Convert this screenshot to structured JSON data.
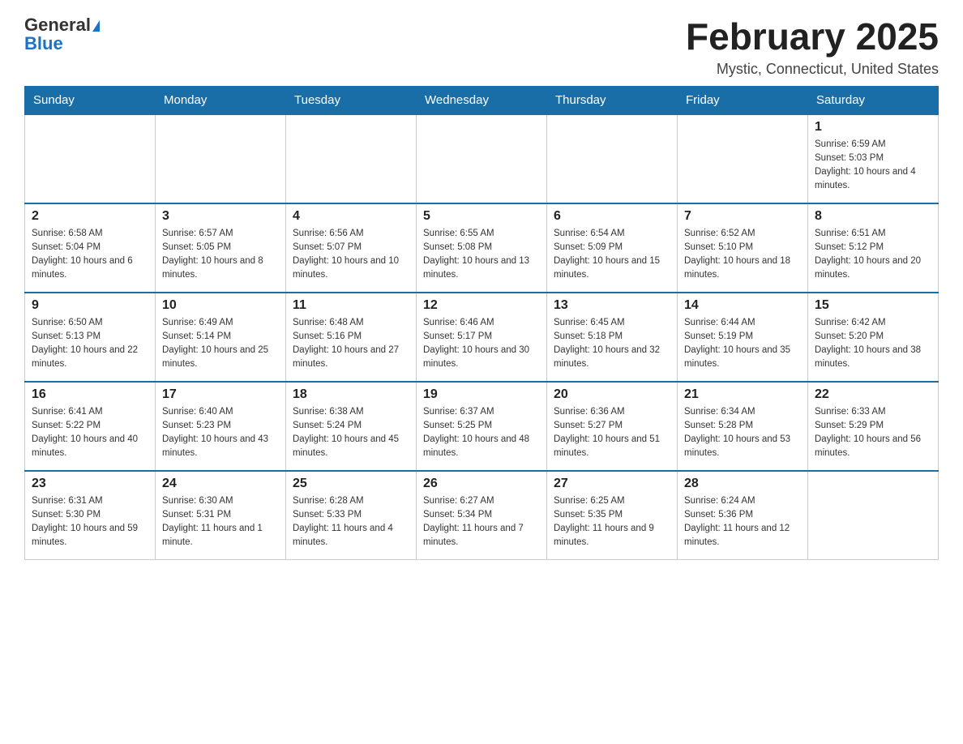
{
  "header": {
    "logo_general": "General",
    "logo_blue": "Blue",
    "month_title": "February 2025",
    "location": "Mystic, Connecticut, United States"
  },
  "days_of_week": [
    "Sunday",
    "Monday",
    "Tuesday",
    "Wednesday",
    "Thursday",
    "Friday",
    "Saturday"
  ],
  "weeks": [
    [
      {
        "day": "",
        "info": ""
      },
      {
        "day": "",
        "info": ""
      },
      {
        "day": "",
        "info": ""
      },
      {
        "day": "",
        "info": ""
      },
      {
        "day": "",
        "info": ""
      },
      {
        "day": "",
        "info": ""
      },
      {
        "day": "1",
        "info": "Sunrise: 6:59 AM\nSunset: 5:03 PM\nDaylight: 10 hours and 4 minutes."
      }
    ],
    [
      {
        "day": "2",
        "info": "Sunrise: 6:58 AM\nSunset: 5:04 PM\nDaylight: 10 hours and 6 minutes."
      },
      {
        "day": "3",
        "info": "Sunrise: 6:57 AM\nSunset: 5:05 PM\nDaylight: 10 hours and 8 minutes."
      },
      {
        "day": "4",
        "info": "Sunrise: 6:56 AM\nSunset: 5:07 PM\nDaylight: 10 hours and 10 minutes."
      },
      {
        "day": "5",
        "info": "Sunrise: 6:55 AM\nSunset: 5:08 PM\nDaylight: 10 hours and 13 minutes."
      },
      {
        "day": "6",
        "info": "Sunrise: 6:54 AM\nSunset: 5:09 PM\nDaylight: 10 hours and 15 minutes."
      },
      {
        "day": "7",
        "info": "Sunrise: 6:52 AM\nSunset: 5:10 PM\nDaylight: 10 hours and 18 minutes."
      },
      {
        "day": "8",
        "info": "Sunrise: 6:51 AM\nSunset: 5:12 PM\nDaylight: 10 hours and 20 minutes."
      }
    ],
    [
      {
        "day": "9",
        "info": "Sunrise: 6:50 AM\nSunset: 5:13 PM\nDaylight: 10 hours and 22 minutes."
      },
      {
        "day": "10",
        "info": "Sunrise: 6:49 AM\nSunset: 5:14 PM\nDaylight: 10 hours and 25 minutes."
      },
      {
        "day": "11",
        "info": "Sunrise: 6:48 AM\nSunset: 5:16 PM\nDaylight: 10 hours and 27 minutes."
      },
      {
        "day": "12",
        "info": "Sunrise: 6:46 AM\nSunset: 5:17 PM\nDaylight: 10 hours and 30 minutes."
      },
      {
        "day": "13",
        "info": "Sunrise: 6:45 AM\nSunset: 5:18 PM\nDaylight: 10 hours and 32 minutes."
      },
      {
        "day": "14",
        "info": "Sunrise: 6:44 AM\nSunset: 5:19 PM\nDaylight: 10 hours and 35 minutes."
      },
      {
        "day": "15",
        "info": "Sunrise: 6:42 AM\nSunset: 5:20 PM\nDaylight: 10 hours and 38 minutes."
      }
    ],
    [
      {
        "day": "16",
        "info": "Sunrise: 6:41 AM\nSunset: 5:22 PM\nDaylight: 10 hours and 40 minutes."
      },
      {
        "day": "17",
        "info": "Sunrise: 6:40 AM\nSunset: 5:23 PM\nDaylight: 10 hours and 43 minutes."
      },
      {
        "day": "18",
        "info": "Sunrise: 6:38 AM\nSunset: 5:24 PM\nDaylight: 10 hours and 45 minutes."
      },
      {
        "day": "19",
        "info": "Sunrise: 6:37 AM\nSunset: 5:25 PM\nDaylight: 10 hours and 48 minutes."
      },
      {
        "day": "20",
        "info": "Sunrise: 6:36 AM\nSunset: 5:27 PM\nDaylight: 10 hours and 51 minutes."
      },
      {
        "day": "21",
        "info": "Sunrise: 6:34 AM\nSunset: 5:28 PM\nDaylight: 10 hours and 53 minutes."
      },
      {
        "day": "22",
        "info": "Sunrise: 6:33 AM\nSunset: 5:29 PM\nDaylight: 10 hours and 56 minutes."
      }
    ],
    [
      {
        "day": "23",
        "info": "Sunrise: 6:31 AM\nSunset: 5:30 PM\nDaylight: 10 hours and 59 minutes."
      },
      {
        "day": "24",
        "info": "Sunrise: 6:30 AM\nSunset: 5:31 PM\nDaylight: 11 hours and 1 minute."
      },
      {
        "day": "25",
        "info": "Sunrise: 6:28 AM\nSunset: 5:33 PM\nDaylight: 11 hours and 4 minutes."
      },
      {
        "day": "26",
        "info": "Sunrise: 6:27 AM\nSunset: 5:34 PM\nDaylight: 11 hours and 7 minutes."
      },
      {
        "day": "27",
        "info": "Sunrise: 6:25 AM\nSunset: 5:35 PM\nDaylight: 11 hours and 9 minutes."
      },
      {
        "day": "28",
        "info": "Sunrise: 6:24 AM\nSunset: 5:36 PM\nDaylight: 11 hours and 12 minutes."
      },
      {
        "day": "",
        "info": ""
      }
    ]
  ]
}
